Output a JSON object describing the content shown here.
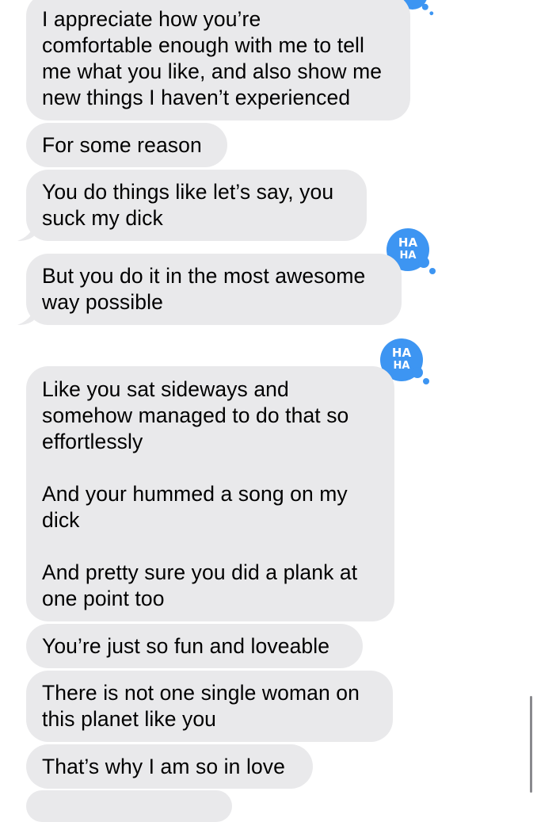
{
  "messages": [
    {
      "text": "I appreciate how you’re\ncomfortable enough with me to tell\nme what you like, and also show me\nnew things I haven’t experienced",
      "reaction": "haha"
    },
    {
      "text": "For some reason"
    },
    {
      "text": "You do things like let’s say, you\nsuck my dick"
    },
    {
      "text": "But you do it in the most awesome\nway possible",
      "reaction": "haha"
    },
    {
      "text": "Like you sat sideways and\nsomehow managed to do that so\neffortlessly\n\nAnd your hummed a song on my\ndick\n\nAnd pretty sure you did a plank at\none point too",
      "reaction": "haha"
    },
    {
      "text": "You’re just so fun and loveable"
    },
    {
      "text": "There is not one single woman on\nthis planet like you"
    },
    {
      "text": "That’s why I am so in love"
    }
  ],
  "reaction_label": {
    "line1": "HA",
    "line2": "HA"
  },
  "colors": {
    "bubble": "#e9e9eb",
    "reaction": "#3d95f2",
    "text": "#000000"
  },
  "icons": {
    "reaction": "haha-reaction-icon"
  }
}
